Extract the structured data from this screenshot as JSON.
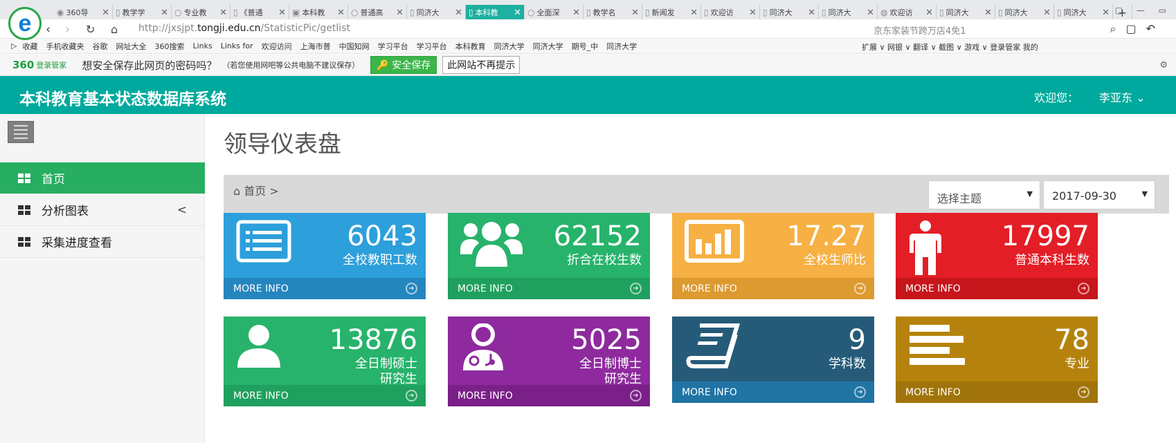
{
  "browser": {
    "tabs": [
      {
        "label": "360导",
        "icon": "360-icon"
      },
      {
        "label": "教学学",
        "icon": "page-icon"
      },
      {
        "label": "专业教",
        "icon": "o-icon"
      },
      {
        "label": "《普通",
        "icon": "page-icon"
      },
      {
        "label": "本科教",
        "icon": "tongji-icon"
      },
      {
        "label": "普通高",
        "icon": "o-icon"
      },
      {
        "label": "同济大",
        "icon": "page-icon"
      },
      {
        "label": "本科教",
        "icon": "page-icon",
        "active": true
      },
      {
        "label": "全面深",
        "icon": "o-icon"
      },
      {
        "label": "教学名",
        "icon": "page-icon"
      },
      {
        "label": "新闻发",
        "icon": "page-icon"
      },
      {
        "label": "欢迎访",
        "icon": "page-icon"
      },
      {
        "label": "同济大",
        "icon": "page-icon"
      },
      {
        "label": "同济大",
        "icon": "page-icon"
      },
      {
        "label": "欢迎访",
        "icon": "globe-icon"
      },
      {
        "label": "同济大",
        "icon": "page-icon"
      },
      {
        "label": "同济大",
        "icon": "page-icon"
      },
      {
        "label": "同济大",
        "icon": "page-icon"
      }
    ],
    "new_tab": "+",
    "url_prefix": "http://jxsjpt.",
    "url_domain": "tongji.edu.cn",
    "url_path": "/StatisticPic/getlist",
    "addr_ad": "京东家装节跨万店4免1",
    "bookmarks": [
      "收藏",
      "手机收藏夹",
      "谷歌",
      "网址大全",
      "360搜索",
      "Links",
      "Links for",
      "欢迎访问",
      "上海市普",
      "中国知网",
      "学习平台",
      "学习平台",
      "本科教育",
      "同济大学",
      "同济大学",
      "期号_中",
      "同济大学"
    ],
    "bookmark_right": "扩展 ∨  网银 ∨  翻译 ∨  截图 ∨  游戏 ∨  登录管家  我的",
    "notice": {
      "brand": "360",
      "login": "登录管家",
      "message": "想安全保存此网页的密码吗？",
      "small": "（若您使用网吧等公共电脑不建议保存）",
      "save": "安全保存",
      "never": "此网站不再提示"
    }
  },
  "app": {
    "title": "本科教育基本状态数据库系统",
    "welcome": "欢迎您：",
    "user": "李亚东"
  },
  "sidebar": {
    "items": [
      {
        "label": "首页",
        "active": true
      },
      {
        "label": "分析图表",
        "chevron": "<"
      },
      {
        "label": "采集进度查看"
      }
    ]
  },
  "main": {
    "page_title": "领导仪表盘",
    "breadcrumb": "首页",
    "breadcrumb_sep": ">",
    "theme_select": "选择主题",
    "date_select": "2017-09-30"
  },
  "cards": [
    {
      "value": "6043",
      "label": "全校教职工数",
      "more": "MORE INFO",
      "color": "#2d9fdb",
      "foot": "#2586be",
      "icon": "id-card-icon"
    },
    {
      "value": "62152",
      "label": "折合在校生数",
      "more": "MORE INFO",
      "color": "#27b36b",
      "foot": "#20a05e",
      "icon": "users-icon"
    },
    {
      "value": "17.27",
      "label": "全校生师比",
      "more": "MORE INFO",
      "color": "#f7b043",
      "foot": "#dc9a30",
      "icon": "bar-chart-icon"
    },
    {
      "value": "17997",
      "label": "普通本科生数",
      "more": "MORE INFO",
      "color": "#e41e26",
      "foot": "#c7151c",
      "icon": "person-icon"
    },
    {
      "value": "13876",
      "label": "全日制硕士\n研究生",
      "more": "MORE INFO",
      "color": "#27b36b",
      "foot": "#20a05e",
      "icon": "user-icon"
    },
    {
      "value": "5025",
      "label": "全日制博士\n研究生",
      "more": "MORE INFO",
      "color": "#8e2a9e",
      "foot": "#7a2088",
      "icon": "doctor-icon"
    },
    {
      "value": "9",
      "label": "学科数",
      "more": "MORE INFO",
      "color": "#255b79",
      "foot": "#2074a4",
      "icon": "book-icon"
    },
    {
      "value": "78",
      "label": "专业",
      "more": "MORE INFO",
      "color": "#b5830d",
      "foot": "#a0740a",
      "icon": "align-left-icon"
    }
  ]
}
